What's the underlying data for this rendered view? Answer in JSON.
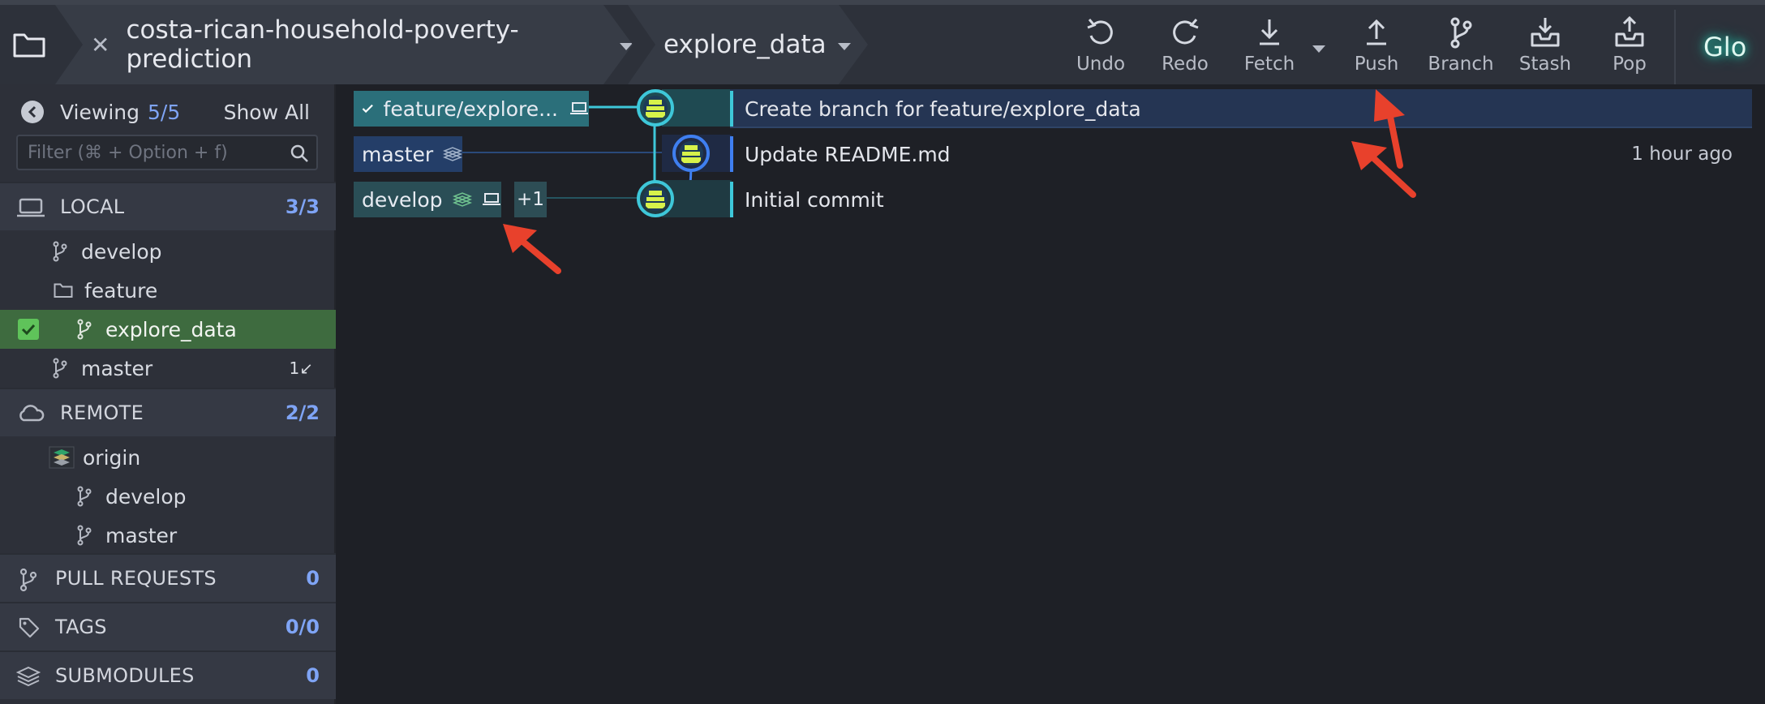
{
  "toolbar": {
    "repo_name": "costa-rican-household-poverty-prediction",
    "branch_name": "explore_data",
    "undo": "Undo",
    "redo": "Redo",
    "fetch": "Fetch",
    "push": "Push",
    "branch": "Branch",
    "stash": "Stash",
    "pop": "Pop",
    "glo": "Glo"
  },
  "sidebar": {
    "viewing_label": "Viewing",
    "viewing_count": "5/5",
    "show_all": "Show All",
    "filter_placeholder": "Filter (⌘ + Option + f)",
    "local": {
      "label": "LOCAL",
      "count": "3/3"
    },
    "local_items": [
      {
        "label": "develop"
      },
      {
        "label": "feature"
      },
      {
        "label": "explore_data",
        "selected": true
      },
      {
        "label": "master",
        "behind": "1↙"
      }
    ],
    "remote": {
      "label": "REMOTE",
      "count": "2/2"
    },
    "remote_items": [
      {
        "label": "origin"
      },
      {
        "label": "develop"
      },
      {
        "label": "master"
      }
    ],
    "pull_requests": {
      "label": "PULL REQUESTS",
      "count": "0"
    },
    "tags": {
      "label": "TAGS",
      "count": "0/0"
    },
    "submodules": {
      "label": "SUBMODULES",
      "count": "0"
    }
  },
  "graph": {
    "commits": [
      {
        "branch_label": "feature/explore...",
        "message": "Create branch for feature/explore_data",
        "time": ""
      },
      {
        "branch_label": "master",
        "message": "Update README.md",
        "time": "1 hour ago"
      },
      {
        "branch_label": "develop",
        "extra": "+1",
        "message": "Initial commit",
        "time": ""
      }
    ]
  },
  "colors": {
    "lane_teal": "#3ec7d9",
    "lane_blue": "#3f7ff0",
    "head_row": "#253553",
    "selected_branch": "#3e6b3f",
    "arrow": "#e8412c"
  }
}
